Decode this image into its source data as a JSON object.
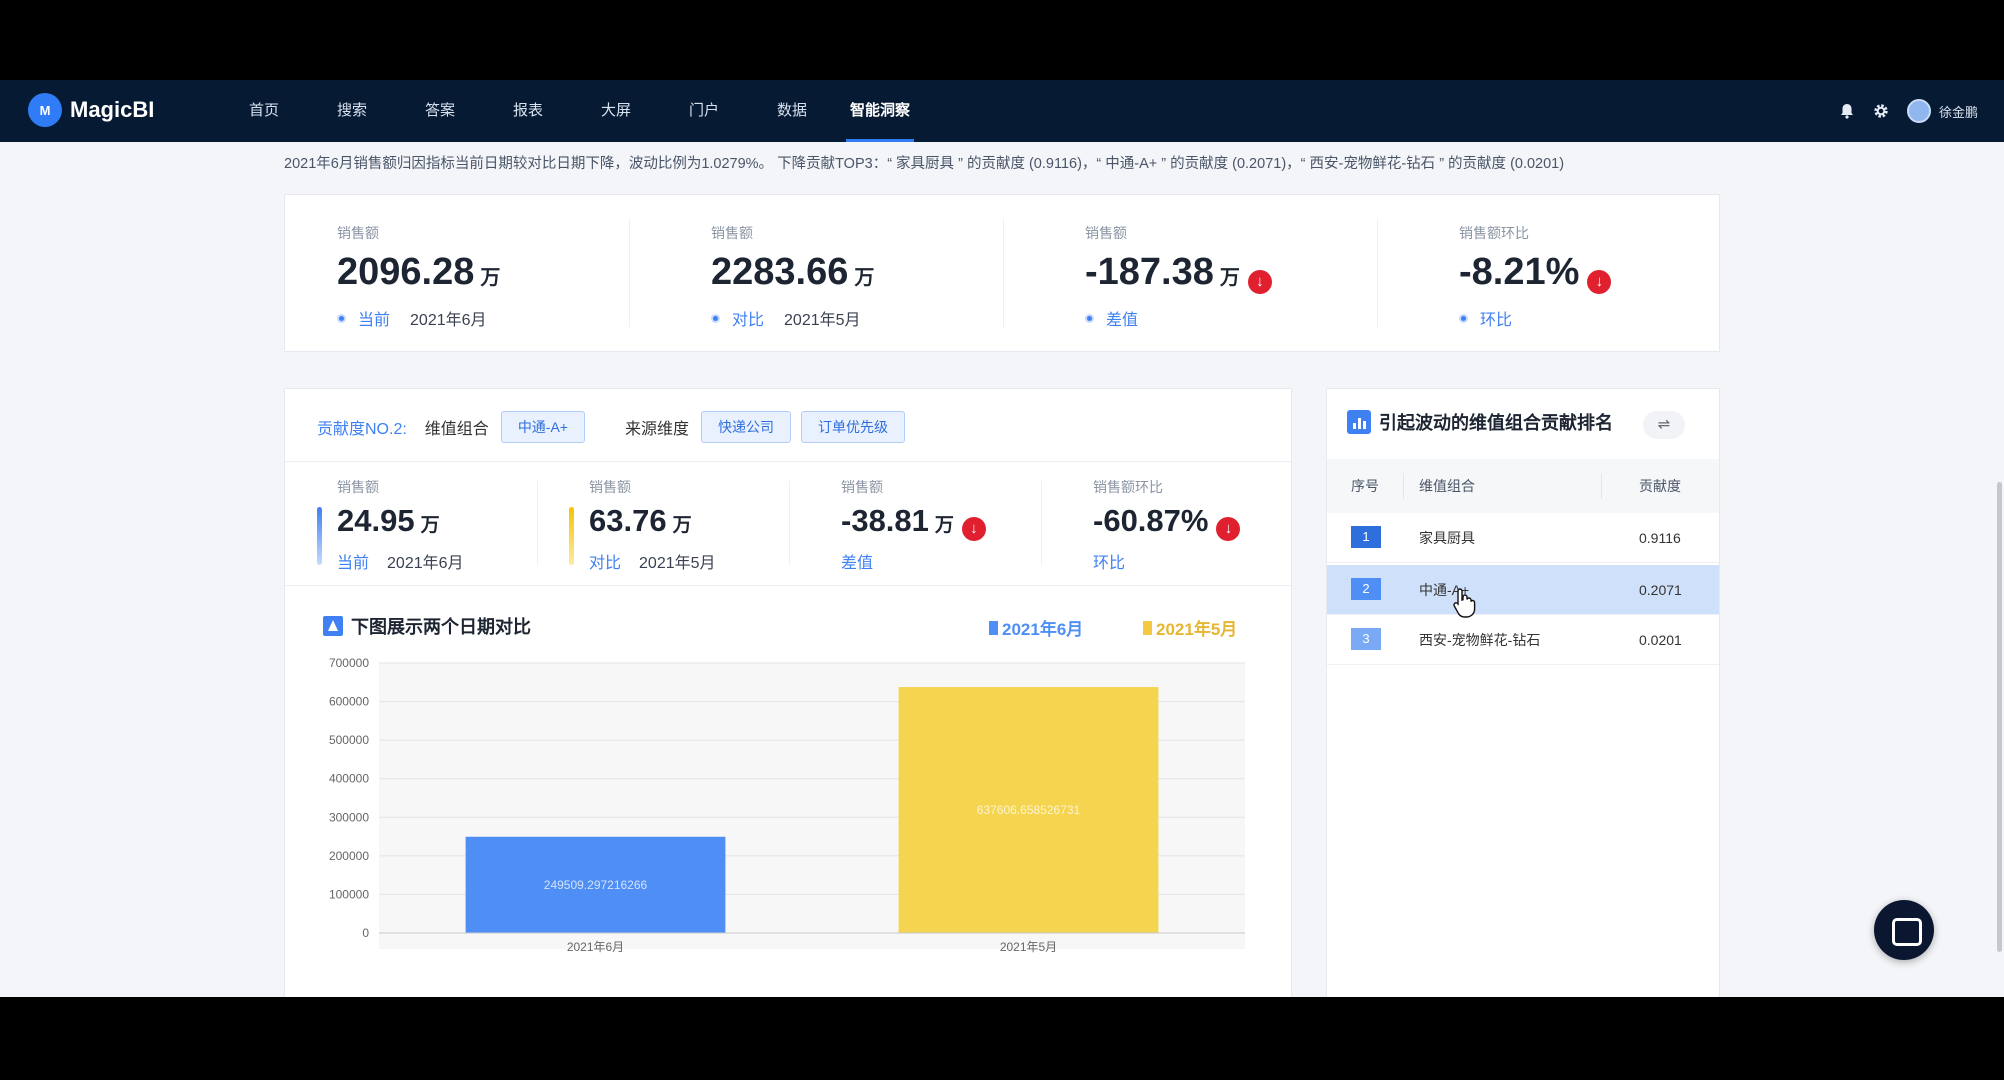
{
  "brand": {
    "logo_mark": "M",
    "name": "MagicBI"
  },
  "nav": {
    "items": [
      "首页",
      "搜索",
      "答案",
      "报表",
      "大屏",
      "门户",
      "数据",
      "智能洞察"
    ],
    "active_index": 7,
    "user": "徐金鹏"
  },
  "summary": "2021年6月销售额归因指标当前日期较对比日期下降，波动比例为1.0279%。 下降贡献TOP3：“ 家具厨具 ” 的贡献度 (0.9116)，“ 中通-A+ ” 的贡献度 (0.2071)，“ 西安-宠物鲜花-钻石 ” 的贡献度 (0.0201)",
  "kpis": [
    {
      "label": "销售额",
      "value": "2096.28",
      "unit": "万",
      "tag": "当前",
      "date": "2021年6月"
    },
    {
      "label": "销售额",
      "value": "2283.66",
      "unit": "万",
      "tag": "对比",
      "date": "2021年5月"
    },
    {
      "label": "销售额",
      "value": "-187.38",
      "unit": "万",
      "tag": "差值",
      "date": ""
    },
    {
      "label": "销售额环比",
      "value": "-8.21%",
      "unit": "",
      "tag": "环比",
      "date": ""
    }
  ],
  "detail": {
    "contrib_label": "贡献度NO.2:",
    "combo_label": "维值组合",
    "combo_chip": "中通-A+",
    "source_label": "来源维度",
    "source_chips": [
      "快递公司",
      "订单优先级"
    ],
    "kpis": [
      {
        "label": "销售额",
        "value": "24.95",
        "unit": "万",
        "tag": "当前",
        "date": "2021年6月"
      },
      {
        "label": "销售额",
        "value": "63.76",
        "unit": "万",
        "tag": "对比",
        "date": "2021年5月"
      },
      {
        "label": "销售额",
        "value": "-38.81",
        "unit": "万",
        "tag": "差值",
        "date": ""
      },
      {
        "label": "销售额环比",
        "value": "-60.87%",
        "unit": "",
        "tag": "环比",
        "date": ""
      }
    ],
    "chart_title": "下图展示两个日期对比"
  },
  "colors": {
    "current": "#4f8ff5",
    "compare": "#f5d44f",
    "accent": "#3f80f3",
    "down": "#e0202e",
    "navbar": "#071a33"
  },
  "chart_data": {
    "type": "bar",
    "categories": [
      "2021年6月",
      "2021年5月"
    ],
    "values": [
      249509.297216266,
      637606.658526731
    ],
    "value_labels": [
      "249509.297216266",
      "637606.658526731"
    ],
    "legend": [
      "2021年6月",
      "2021年5月"
    ],
    "legend_position": "top-right",
    "ylim": [
      0,
      700000
    ],
    "yticks": [
      "0",
      "100000",
      "200000",
      "300000",
      "400000",
      "500000",
      "600000",
      "700000"
    ],
    "grid": true
  },
  "ranking": {
    "title": "引起波动的维值组合贡献排名",
    "headers": [
      "序号",
      "维值组合",
      "贡献度"
    ],
    "rows": [
      {
        "rank": "1",
        "name": "家具厨具",
        "score": "0.9116"
      },
      {
        "rank": "2",
        "name": "中通-A+",
        "score": "0.2071"
      },
      {
        "rank": "3",
        "name": "西安-宠物鲜花-钻石",
        "score": "0.0201"
      }
    ],
    "selected_index": 1,
    "icons": {
      "swap": "swap-icon",
      "title": "bar-chart-icon"
    }
  }
}
